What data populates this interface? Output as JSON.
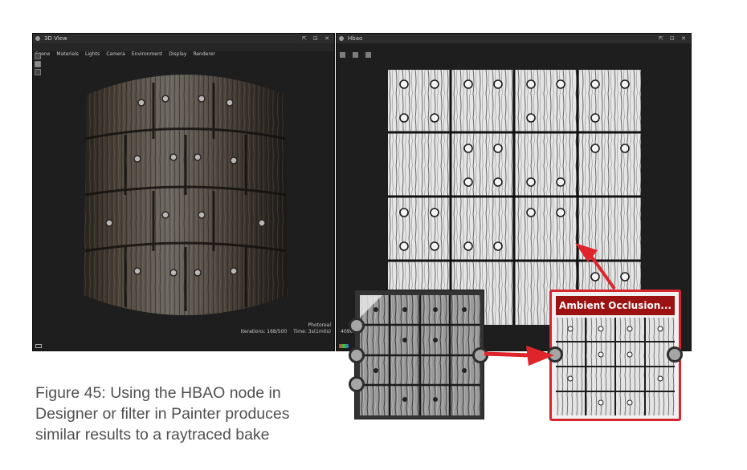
{
  "view3d": {
    "title": "3D View",
    "window_buttons": "⇱ ⊡ ✕",
    "menu": [
      "Scene",
      "Materials",
      "Lights",
      "Camera",
      "Environment",
      "Display",
      "Renderer"
    ],
    "status_mode": "Photoreal",
    "status_iterations": "Iterations: 168/500",
    "status_time": "Time: 3s(1m0s)"
  },
  "hbao_view": {
    "title": "Hbao",
    "window_buttons": "⇱ ⊡ ✕",
    "resolution": "4096"
  },
  "node_ao": {
    "label": "Ambient Occlusion..."
  },
  "caption": "Figure 45: Using the HBAO node in Designer or filter in Painter produces similar results to a raytraced bake",
  "colors": {
    "panel_bg": "#1e1e1e",
    "ao_header": "#9c1111",
    "ao_border": "#d8262e",
    "arrow": "#e0242b",
    "caption_text": "#505050"
  },
  "icons": [
    "view-icon",
    "select-tool-icon",
    "hand-tool-icon",
    "light-tool-icon",
    "arrow-icon"
  ]
}
